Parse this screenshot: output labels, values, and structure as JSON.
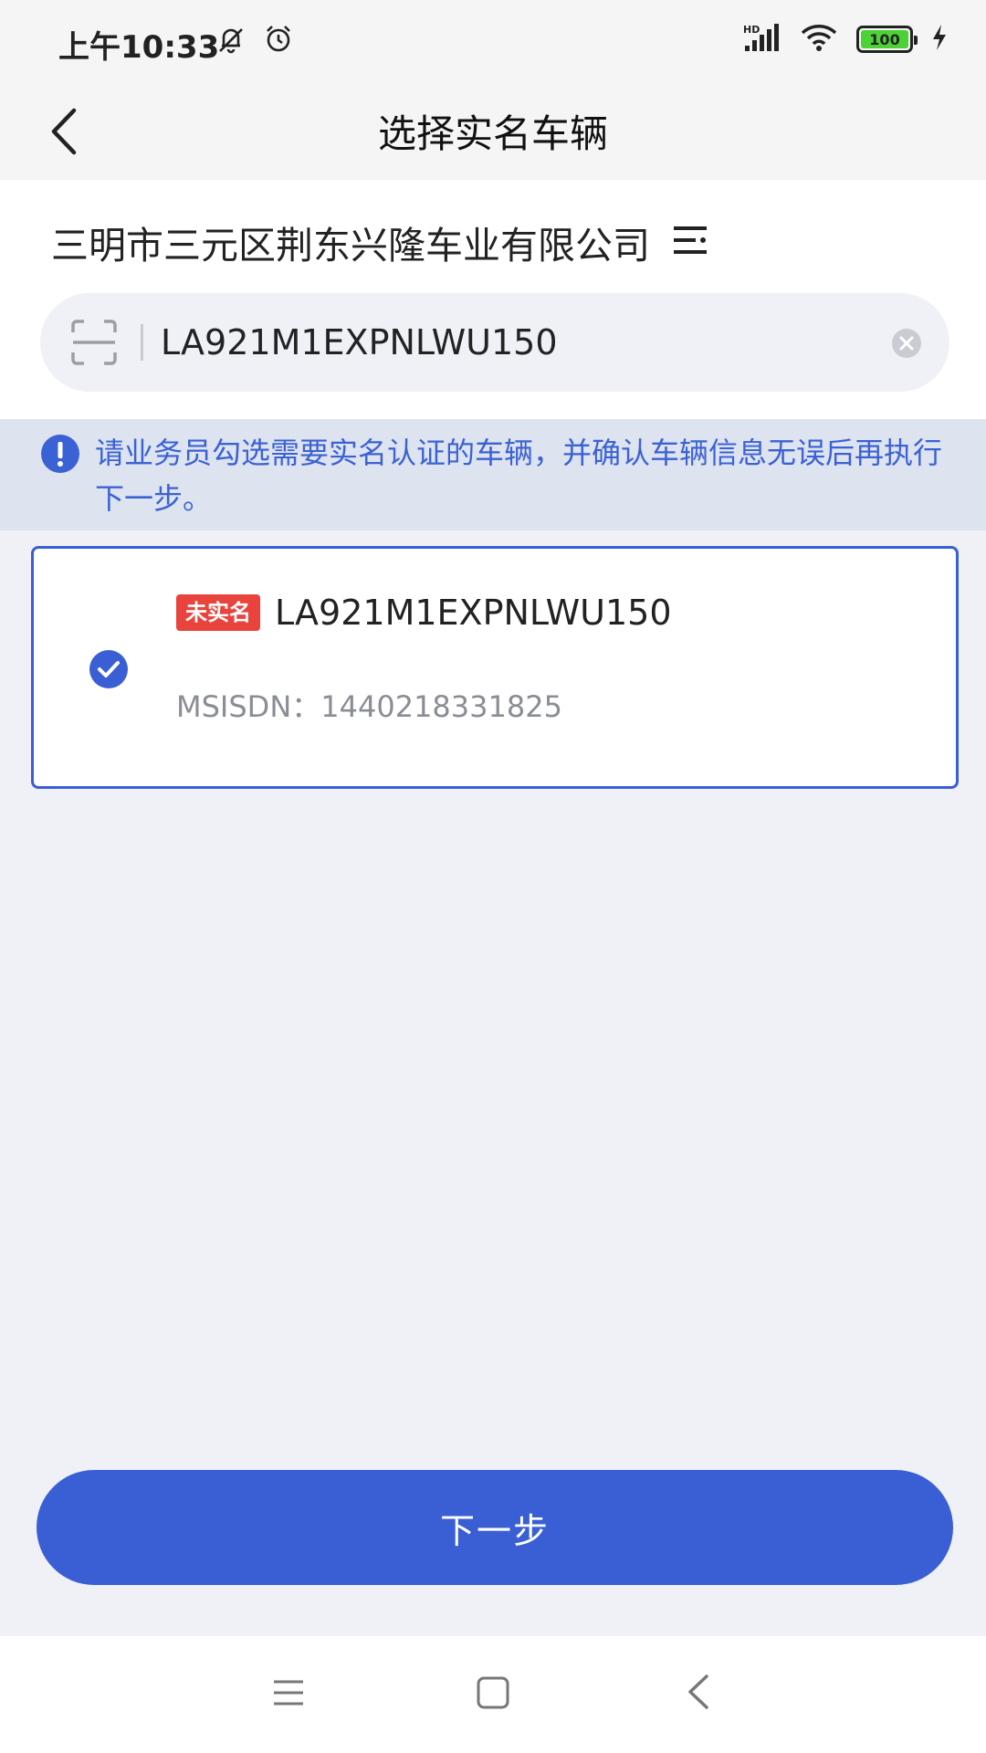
{
  "status_bar": {
    "time": "上午10:33",
    "battery": "100",
    "network": "HD"
  },
  "header": {
    "title": "选择实名车辆"
  },
  "company": {
    "name": "三明市三元区荆东兴隆车业有限公司"
  },
  "search": {
    "value": "LA921M1EXPNLWU150"
  },
  "notice": {
    "text": "请业务员勾选需要实名认证的车辆，并确认车辆信息无误后再执行下一步。"
  },
  "vehicles": [
    {
      "badge": "未实名",
      "vin": "LA921M1EXPNLWU150",
      "msisdn_label": "MSISDN：",
      "msisdn": "1440218331825",
      "selected": true
    }
  ],
  "actions": {
    "next_label": "下一步"
  },
  "colors": {
    "accent": "#3a5fd4",
    "badge_red": "#e8433c",
    "notice_bg": "#dde3ef",
    "page_bg": "#eff1f6"
  }
}
